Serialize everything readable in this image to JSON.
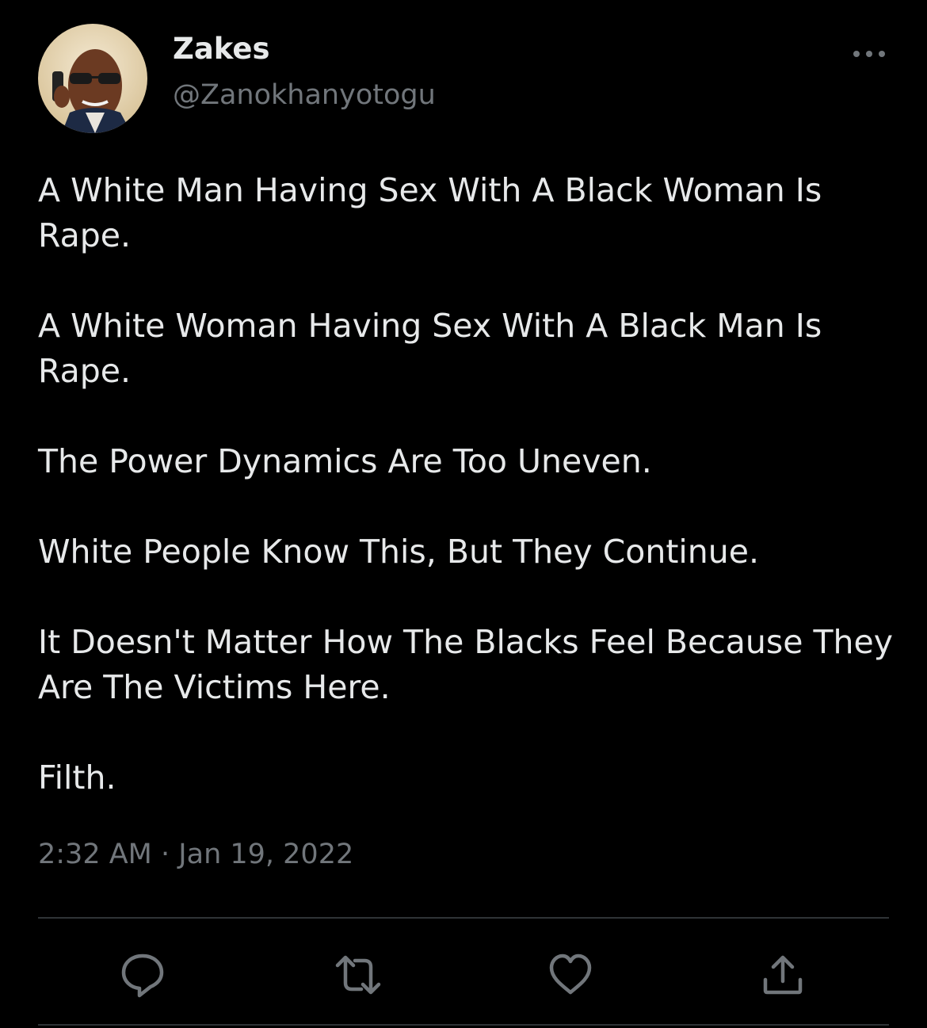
{
  "tweet": {
    "author": {
      "display_name": "Zakes",
      "handle": "@Zanokhanyotogu"
    },
    "paragraphs": [
      "A White Man Having Sex With A Black Woman Is Rape.",
      "A White Woman Having Sex With A Black Man Is Rape.",
      "The Power Dynamics Are Too Uneven.",
      "White People Know This, But They Continue.",
      "It Doesn't Matter How The Blacks Feel Because They Are The Victims Here.",
      "Filth."
    ],
    "timestamp": "2:32 AM",
    "separator": "·",
    "date": "Jan 19, 2022"
  },
  "icons": {
    "more": "more-horizontal-icon",
    "reply": "reply-bubble-icon",
    "retweet": "retweet-icon",
    "like": "heart-icon",
    "share": "share-upload-icon"
  },
  "colors": {
    "background": "#000000",
    "primary_text": "#e7e9ea",
    "secondary_text": "#71767b",
    "divider": "#2f3336"
  }
}
